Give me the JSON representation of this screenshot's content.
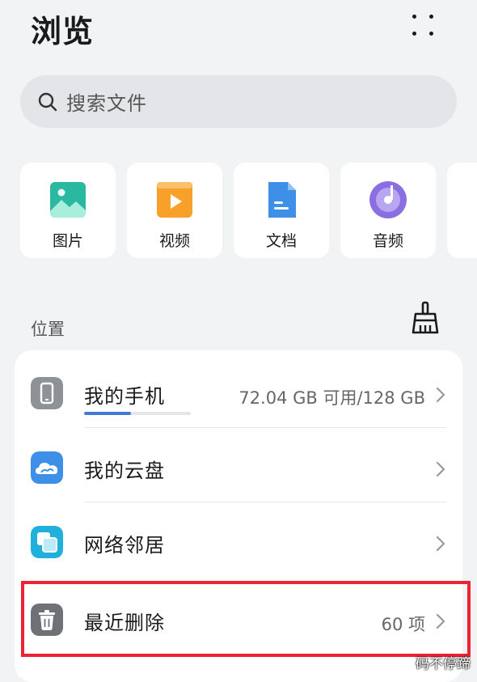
{
  "header": {
    "title": "浏览",
    "more_icon": "more-dots-icon"
  },
  "search": {
    "placeholder": "搜索文件",
    "icon": "search-icon"
  },
  "categories": [
    {
      "label": "图片",
      "icon": "image-icon",
      "color": "#2bb8a0"
    },
    {
      "label": "视频",
      "icon": "video-icon",
      "color": "#f7a12a"
    },
    {
      "label": "文档",
      "icon": "document-icon",
      "color": "#3d8fe8"
    },
    {
      "label": "音频",
      "icon": "audio-icon",
      "color": "#8b6fe0"
    }
  ],
  "locations": {
    "section_title": "位置",
    "clean_icon": "broom-icon",
    "items": [
      {
        "label": "我的手机",
        "value": "72.04 GB 可用/128 GB",
        "icon": "phone-icon",
        "storage_used_fraction": 0.44
      },
      {
        "label": "我的云盘",
        "value": "",
        "icon": "cloud-icon"
      },
      {
        "label": "网络邻居",
        "value": "",
        "icon": "network-icon"
      },
      {
        "label": "最近删除",
        "value": "60 项",
        "icon": "trash-icon"
      }
    ]
  },
  "watermark": "码不停蹄",
  "colors": {
    "highlight": "#ee2233",
    "accent": "#3f7bd6"
  }
}
